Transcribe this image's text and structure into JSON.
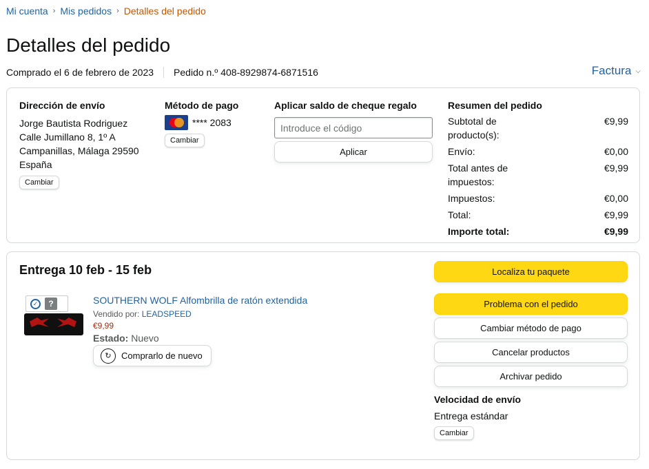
{
  "breadcrumb": {
    "items": [
      "Mi cuenta",
      "Mis pedidos"
    ],
    "current": "Detalles del pedido",
    "separator": "›"
  },
  "page_title": "Detalles del pedido",
  "order_meta": {
    "purchased": "Comprado el 6 de febrero de 2023",
    "order_number": "Pedido n.º 408-8929874-6871516"
  },
  "invoice": {
    "label": "Factura",
    "icon": "chevron-down-icon"
  },
  "shipping": {
    "title": "Dirección de envío",
    "name": "Jorge Bautista Rodriguez",
    "street": "Calle Jumillano 8, 1º A",
    "city": "Campanillas, Málaga 29590",
    "country": "España",
    "change": "Cambiar"
  },
  "payment": {
    "title": "Método de pago",
    "card_icon": "mastercard-icon",
    "card": "**** 2083",
    "change": "Cambiar"
  },
  "gift": {
    "title": "Aplicar saldo de cheque regalo",
    "placeholder": "Introduce el código",
    "apply": "Aplicar"
  },
  "summary": {
    "title": "Resumen del pedido",
    "rows": [
      {
        "label": "Subtotal de producto(s):",
        "value": "€9,99"
      },
      {
        "label": "Envío:",
        "value": "€0,00"
      },
      {
        "label": "Total antes de impuestos:",
        "value": "€9,99"
      },
      {
        "label": "Impuestos:",
        "value": "€0,00"
      },
      {
        "label": "Total:",
        "value": "€9,99"
      }
    ],
    "grand_total": {
      "label": "Importe total:",
      "value": "€9,99"
    }
  },
  "delivery": {
    "title": "Entrega 10 feb - 15 feb",
    "item": {
      "name": "SOUTHERN WOLF Alfombrilla de ratón extendida",
      "sold_by_label": "Vendido por: ",
      "seller": "LEADSPEED",
      "price": "€9,99",
      "status_label": "Estado:",
      "status_value": "Nuevo",
      "rebuy": "Comprarlo de nuevo",
      "badge_check_icon": "check-circle-icon",
      "badge_question": "?"
    },
    "actions": {
      "track": "Localiza tu paquete",
      "problem": "Problema con el pedido",
      "change_payment": "Cambiar método de pago",
      "cancel": "Cancelar productos",
      "archive": "Archivar pedido"
    },
    "speed": {
      "title": "Velocidad de envío",
      "value": "Entrega estándar",
      "change": "Cambiar"
    }
  },
  "colors": {
    "link": "#2162a1",
    "current_breadcrumb": "#c45500",
    "price": "#b12704",
    "primary_button": "#ffd814"
  }
}
